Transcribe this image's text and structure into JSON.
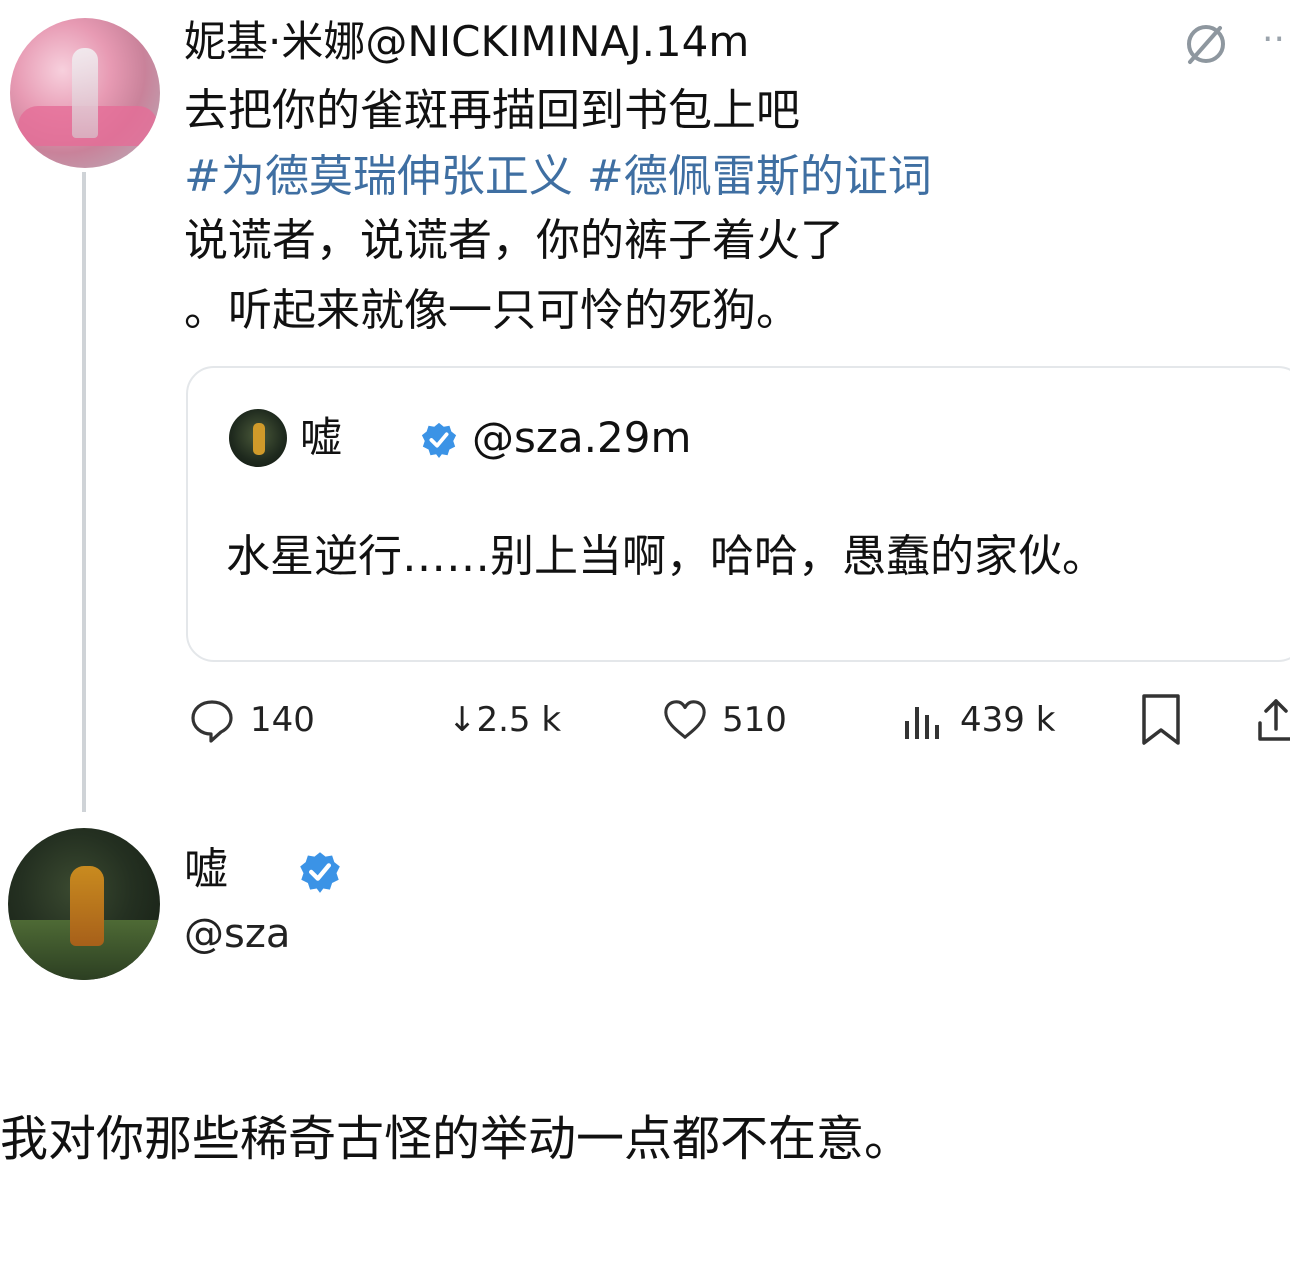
{
  "tweet": {
    "author_display": "妮基·米娜",
    "handle_time": "@NICKIMINAJ.14m",
    "line1": "去把你的雀斑再描回到书包上吧",
    "hashtags": "#为德莫瑞伸张正义 #德佩雷斯的证词",
    "line2": "说谎者，说谎者，你的裤子着火了",
    "line3": "。听起来就像一只可怜的死狗。",
    "icons": {
      "mute": "mute-icon",
      "more": "more-icon"
    }
  },
  "quote": {
    "name": "嘘",
    "handle_time": "@sza.29m",
    "text": "水星逆行……别上当啊，哈哈，愚蠢的家伙。",
    "verified_icon": "verified-badge-icon"
  },
  "actions": {
    "replies": "140",
    "reposts": "↓2.5 k",
    "likes": "510",
    "views": "439 k",
    "icons": [
      "reply-icon",
      "repost-icon",
      "like-icon",
      "views-icon",
      "bookmark-icon",
      "share-icon"
    ]
  },
  "profile": {
    "name": "嘘",
    "handle": "@sza",
    "verified_icon": "verified-badge-icon"
  },
  "caption": "我对你那些稀奇古怪的举动一点都不在意。",
  "colors": {
    "hashtag": "#3f6fa2",
    "verified": "#3b93e6",
    "divider": "#e4e7ea",
    "thread_line": "#cfd3d7"
  }
}
